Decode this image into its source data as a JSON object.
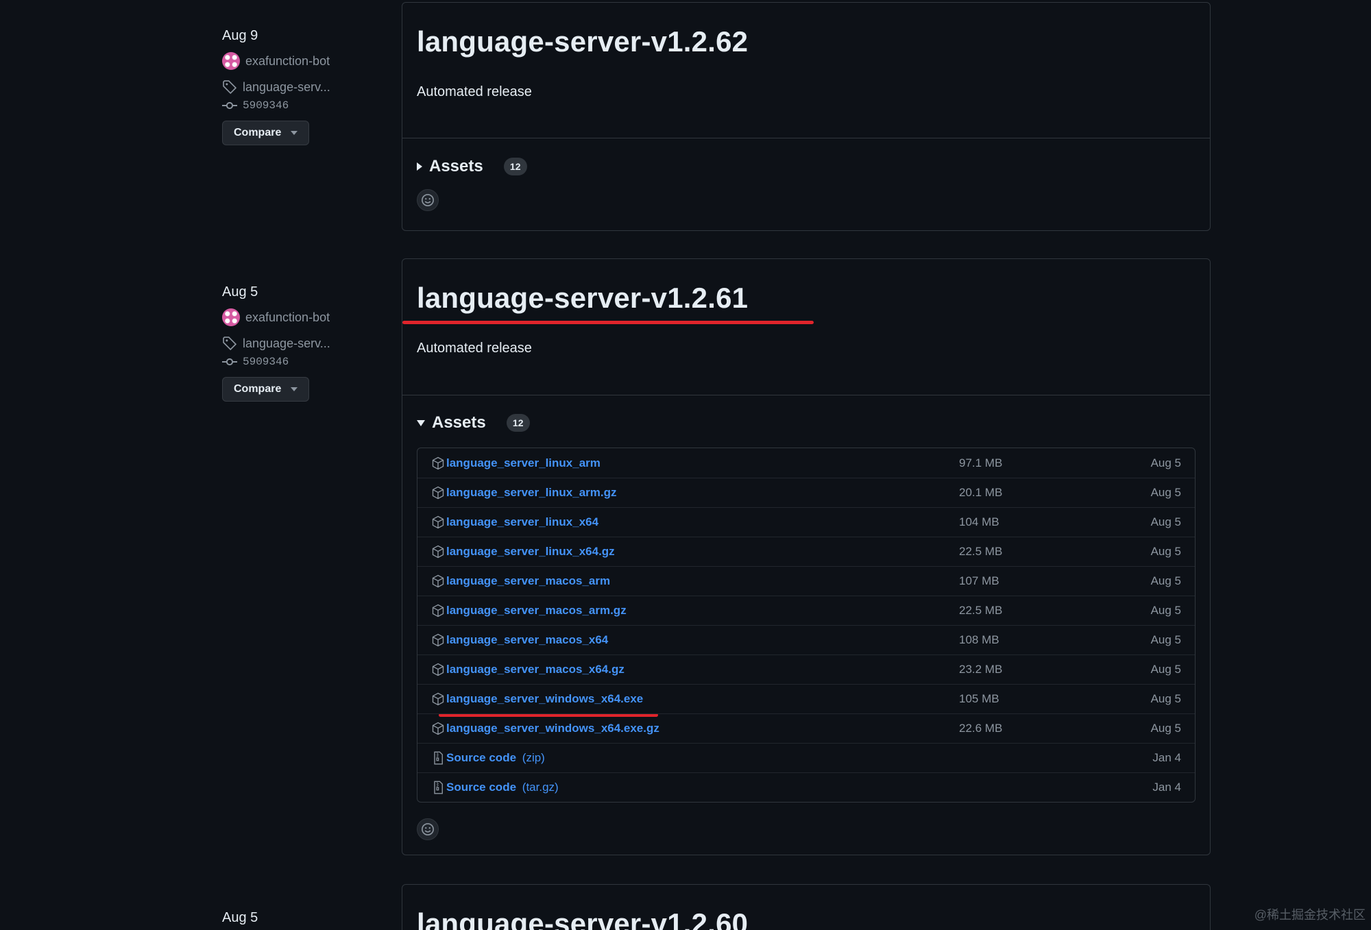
{
  "releases": [
    {
      "date": "Aug 9",
      "author": "exafunction-bot",
      "tag": "language-serv...",
      "commit": "5909346",
      "compare_label": "Compare",
      "title": "language-server-v1.2.62",
      "body": "Automated release",
      "assets_label": "Assets",
      "assets_count": "12"
    },
    {
      "date": "Aug 5",
      "author": "exafunction-bot",
      "tag": "language-serv...",
      "commit": "5909346",
      "compare_label": "Compare",
      "title": "language-server-v1.2.61",
      "body": "Automated release",
      "assets_label": "Assets",
      "assets_count": "12",
      "assets": [
        {
          "name": "language_server_linux_arm",
          "size": "97.1 MB",
          "date": "Aug 5"
        },
        {
          "name": "language_server_linux_arm.gz",
          "size": "20.1 MB",
          "date": "Aug 5"
        },
        {
          "name": "language_server_linux_x64",
          "size": "104 MB",
          "date": "Aug 5"
        },
        {
          "name": "language_server_linux_x64.gz",
          "size": "22.5 MB",
          "date": "Aug 5"
        },
        {
          "name": "language_server_macos_arm",
          "size": "107 MB",
          "date": "Aug 5"
        },
        {
          "name": "language_server_macos_arm.gz",
          "size": "22.5 MB",
          "date": "Aug 5"
        },
        {
          "name": "language_server_macos_x64",
          "size": "108 MB",
          "date": "Aug 5"
        },
        {
          "name": "language_server_macos_x64.gz",
          "size": "23.2 MB",
          "date": "Aug 5"
        },
        {
          "name": "language_server_windows_x64.exe",
          "size": "105 MB",
          "date": "Aug 5"
        },
        {
          "name": "language_server_windows_x64.exe.gz",
          "size": "22.6 MB",
          "date": "Aug 5"
        }
      ],
      "source": [
        {
          "name": "Source code",
          "suffix": "(zip)",
          "date": "Jan 4"
        },
        {
          "name": "Source code",
          "suffix": "(tar.gz)",
          "date": "Jan 4"
        }
      ]
    },
    {
      "date": "Aug 5",
      "title": "language-server-v1.2.60"
    }
  ],
  "icons": {
    "package": "package-icon",
    "file_zip": "file-zip-icon",
    "tag": "tag-icon",
    "commit": "git-commit-icon",
    "emoji": "smiley-icon"
  },
  "colors": {
    "link": "#4493f8",
    "highlight": "#e0242b",
    "background": "#0d1117"
  },
  "watermark": "@稀土掘金技术社区"
}
